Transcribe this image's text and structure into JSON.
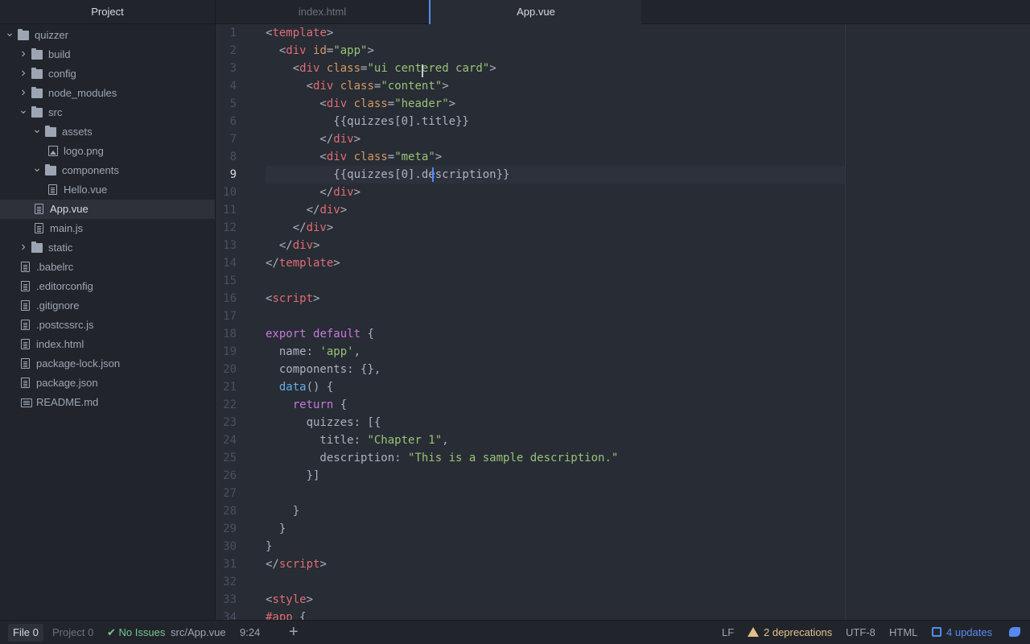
{
  "sidebar": {
    "title": "Project",
    "items": [
      {
        "label": "quizzer",
        "kind": "folder",
        "depth": 0,
        "expanded": true
      },
      {
        "label": "build",
        "kind": "folder",
        "depth": 1,
        "expanded": false
      },
      {
        "label": "config",
        "kind": "folder",
        "depth": 1,
        "expanded": false
      },
      {
        "label": "node_modules",
        "kind": "folder",
        "depth": 1,
        "expanded": false
      },
      {
        "label": "src",
        "kind": "folder",
        "depth": 1,
        "expanded": true
      },
      {
        "label": "assets",
        "kind": "folder",
        "depth": 2,
        "expanded": true
      },
      {
        "label": "logo.png",
        "kind": "image",
        "depth": 3
      },
      {
        "label": "components",
        "kind": "folder",
        "depth": 2,
        "expanded": true
      },
      {
        "label": "Hello.vue",
        "kind": "file",
        "depth": 3
      },
      {
        "label": "App.vue",
        "kind": "file",
        "depth": 2,
        "selected": true
      },
      {
        "label": "main.js",
        "kind": "file",
        "depth": 2
      },
      {
        "label": "static",
        "kind": "folder",
        "depth": 1,
        "expanded": false
      },
      {
        "label": ".babelrc",
        "kind": "file",
        "depth": 1
      },
      {
        "label": ".editorconfig",
        "kind": "file",
        "depth": 1
      },
      {
        "label": ".gitignore",
        "kind": "file",
        "depth": 1
      },
      {
        "label": ".postcssrc.js",
        "kind": "file",
        "depth": 1
      },
      {
        "label": "index.html",
        "kind": "file",
        "depth": 1
      },
      {
        "label": "package-lock.json",
        "kind": "file",
        "depth": 1
      },
      {
        "label": "package.json",
        "kind": "file",
        "depth": 1
      },
      {
        "label": "README.md",
        "kind": "markdown",
        "depth": 1
      }
    ]
  },
  "tabs": [
    {
      "label": "index.html",
      "active": false
    },
    {
      "label": "App.vue",
      "active": true
    }
  ],
  "editor": {
    "active_line": 9,
    "lines": [
      [
        [
          "t-pun",
          "<"
        ],
        [
          "t-tag",
          "template"
        ],
        [
          "t-pun",
          ">"
        ]
      ],
      [
        [
          "t-pun",
          "  <"
        ],
        [
          "t-tag",
          "div"
        ],
        [
          "t-pun",
          " "
        ],
        [
          "t-attr",
          "id"
        ],
        [
          "t-pun",
          "="
        ],
        [
          "t-str",
          "\"app\""
        ],
        [
          "t-pun",
          ">"
        ]
      ],
      [
        [
          "t-pun",
          "    <"
        ],
        [
          "t-tag",
          "div"
        ],
        [
          "t-pun",
          " "
        ],
        [
          "t-attr",
          "class"
        ],
        [
          "t-pun",
          "="
        ],
        [
          "t-str",
          "\"ui centered card\""
        ],
        [
          "t-pun",
          ">"
        ]
      ],
      [
        [
          "t-pun",
          "      <"
        ],
        [
          "t-tag",
          "div"
        ],
        [
          "t-pun",
          " "
        ],
        [
          "t-attr",
          "class"
        ],
        [
          "t-pun",
          "="
        ],
        [
          "t-str",
          "\"content\""
        ],
        [
          "t-pun",
          ">"
        ]
      ],
      [
        [
          "t-pun",
          "        <"
        ],
        [
          "t-tag",
          "div"
        ],
        [
          "t-pun",
          " "
        ],
        [
          "t-attr",
          "class"
        ],
        [
          "t-pun",
          "="
        ],
        [
          "t-str",
          "\"header\""
        ],
        [
          "t-pun",
          ">"
        ]
      ],
      [
        [
          "t-pun",
          "          {{quizzes[0].title}}"
        ]
      ],
      [
        [
          "t-pun",
          "        </"
        ],
        [
          "t-tag",
          "div"
        ],
        [
          "t-pun",
          ">"
        ]
      ],
      [
        [
          "t-pun",
          "        <"
        ],
        [
          "t-tag",
          "div"
        ],
        [
          "t-pun",
          " "
        ],
        [
          "t-attr",
          "class"
        ],
        [
          "t-pun",
          "="
        ],
        [
          "t-str",
          "\"meta\""
        ],
        [
          "t-pun",
          ">"
        ]
      ],
      [
        [
          "t-pun",
          "          {{quizzes[0].description}}"
        ]
      ],
      [
        [
          "t-pun",
          "        </"
        ],
        [
          "t-tag",
          "div"
        ],
        [
          "t-pun",
          ">"
        ]
      ],
      [
        [
          "t-pun",
          "      </"
        ],
        [
          "t-tag",
          "div"
        ],
        [
          "t-pun",
          ">"
        ]
      ],
      [
        [
          "t-pun",
          "    </"
        ],
        [
          "t-tag",
          "div"
        ],
        [
          "t-pun",
          ">"
        ]
      ],
      [
        [
          "t-pun",
          "  </"
        ],
        [
          "t-tag",
          "div"
        ],
        [
          "t-pun",
          ">"
        ]
      ],
      [
        [
          "t-pun",
          "</"
        ],
        [
          "t-tag",
          "template"
        ],
        [
          "t-pun",
          ">"
        ]
      ],
      [],
      [
        [
          "t-pun",
          "<"
        ],
        [
          "t-tag",
          "script"
        ],
        [
          "t-pun",
          ">"
        ]
      ],
      [],
      [
        [
          "t-kw",
          "export"
        ],
        [
          "t-pun",
          " "
        ],
        [
          "t-kw",
          "default"
        ],
        [
          "t-pun",
          " {"
        ]
      ],
      [
        [
          "t-pun",
          "  name: "
        ],
        [
          "t-str",
          "'app'"
        ],
        [
          "t-pun",
          ","
        ]
      ],
      [
        [
          "t-pun",
          "  components: {},"
        ]
      ],
      [
        [
          "t-pun",
          "  "
        ],
        [
          "t-fn",
          "data"
        ],
        [
          "t-pun",
          "() {"
        ]
      ],
      [
        [
          "t-pun",
          "    "
        ],
        [
          "t-kw",
          "return"
        ],
        [
          "t-pun",
          " {"
        ]
      ],
      [
        [
          "t-pun",
          "      quizzes: [{"
        ]
      ],
      [
        [
          "t-pun",
          "        title: "
        ],
        [
          "t-str",
          "\"Chapter 1\""
        ],
        [
          "t-pun",
          ","
        ]
      ],
      [
        [
          "t-pun",
          "        description: "
        ],
        [
          "t-str",
          "\"This is a sample description.\""
        ]
      ],
      [
        [
          "t-pun",
          "      }]"
        ]
      ],
      [],
      [
        [
          "t-pun",
          "    }"
        ]
      ],
      [
        [
          "t-pun",
          "  }"
        ]
      ],
      [
        [
          "t-pun",
          "}"
        ]
      ],
      [
        [
          "t-pun",
          "</"
        ],
        [
          "t-tag",
          "script"
        ],
        [
          "t-pun",
          ">"
        ]
      ],
      [],
      [
        [
          "t-pun",
          "<"
        ],
        [
          "t-tag",
          "style"
        ],
        [
          "t-pun",
          ">"
        ]
      ],
      [
        [
          "t-sel",
          "#app"
        ],
        [
          "t-pun",
          " {"
        ]
      ]
    ]
  },
  "status": {
    "file_label": "File",
    "file_count": "0",
    "project_label": "Project",
    "project_count": "0",
    "no_issues": "No Issues",
    "path": "src/App.vue",
    "cursor_pos": "9:24",
    "add_symbol": "+",
    "line_ending": "LF",
    "deprecations": "2 deprecations",
    "encoding": "UTF-8",
    "grammar": "HTML",
    "updates": "4 updates"
  },
  "colors": {
    "accent": "#568af2",
    "warning": "#e2c08d",
    "ok": "#73c990"
  }
}
